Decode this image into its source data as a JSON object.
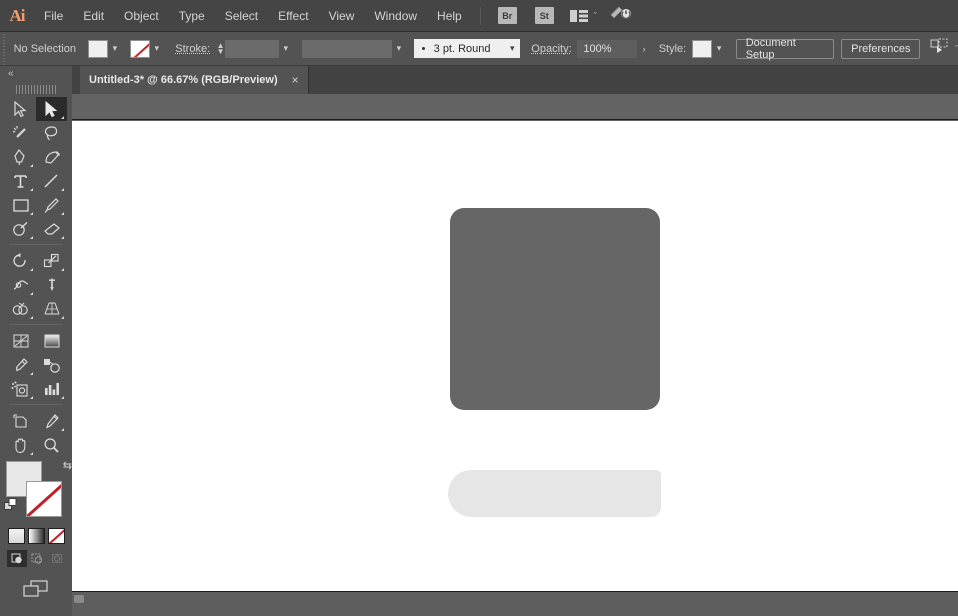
{
  "app": {
    "name": "Adobe Illustrator",
    "logo_text": "Ai"
  },
  "menubar": {
    "items": [
      {
        "label": "File"
      },
      {
        "label": "Edit"
      },
      {
        "label": "Object"
      },
      {
        "label": "Type"
      },
      {
        "label": "Select"
      },
      {
        "label": "Effect"
      },
      {
        "label": "View"
      },
      {
        "label": "Window"
      },
      {
        "label": "Help"
      }
    ],
    "bridge_label": "Br",
    "stock_label": "St",
    "arrange_icon": "arrange-documents-icon",
    "arrange_chevron": "ˇ",
    "workspace_icon": "workspace-switcher-icon"
  },
  "controlbar": {
    "selection_status": "No Selection",
    "fill_swatch": {
      "name": "fill-swatch",
      "color": "#efefef"
    },
    "stroke_swatch": {
      "name": "stroke-swatch",
      "color": "none"
    },
    "stroke_label": "Stroke:",
    "stroke_weight_value": "",
    "variable_width_value": "",
    "brush_definition": "3 pt. Round",
    "opacity_label": "Opacity:",
    "opacity_value": "100%",
    "opacity_more": "›",
    "style_label": "Style:",
    "style_swatch_color": "#efefef",
    "document_setup_label": "Document Setup",
    "preferences_label": "Preferences",
    "align_icon": "align-transform-icon",
    "chevron": "ˇ"
  },
  "tabstrip": {
    "document_title": "Untitled-3* @ 66.67% (RGB/Preview)",
    "close_glyph": "×"
  },
  "toolbar": {
    "collapse_glyph": "«",
    "tools": [
      {
        "name": "selection-tool",
        "label": "Selection",
        "active": false,
        "flyout": false
      },
      {
        "name": "direct-selection-tool",
        "label": "Direct Selection",
        "active": true,
        "flyout": true
      },
      {
        "name": "magic-wand-tool",
        "label": "Magic Wand",
        "active": false,
        "flyout": false
      },
      {
        "name": "lasso-tool",
        "label": "Lasso",
        "active": false,
        "flyout": false
      },
      {
        "name": "pen-tool",
        "label": "Pen",
        "active": false,
        "flyout": true
      },
      {
        "name": "curvature-tool",
        "label": "Curvature",
        "active": false,
        "flyout": false
      },
      {
        "name": "type-tool",
        "label": "Type",
        "active": false,
        "flyout": true
      },
      {
        "name": "line-segment-tool",
        "label": "Line Segment",
        "active": false,
        "flyout": true
      },
      {
        "name": "rectangle-tool",
        "label": "Rectangle",
        "active": false,
        "flyout": true
      },
      {
        "name": "paintbrush-tool",
        "label": "Paintbrush",
        "active": false,
        "flyout": true
      },
      {
        "name": "shaper-tool",
        "label": "Shaper",
        "active": false,
        "flyout": true
      },
      {
        "name": "eraser-tool",
        "label": "Eraser",
        "active": false,
        "flyout": true
      },
      {
        "name": "rotate-tool",
        "label": "Rotate",
        "active": false,
        "flyout": true
      },
      {
        "name": "scale-tool",
        "label": "Scale",
        "active": false,
        "flyout": true
      },
      {
        "name": "width-tool",
        "label": "Width",
        "active": false,
        "flyout": true
      },
      {
        "name": "free-transform-tool",
        "label": "Free Transform",
        "active": false,
        "flyout": false
      },
      {
        "name": "shape-builder-tool",
        "label": "Shape Builder",
        "active": false,
        "flyout": true
      },
      {
        "name": "perspective-grid-tool",
        "label": "Perspective Grid",
        "active": false,
        "flyout": true
      },
      {
        "name": "mesh-tool",
        "label": "Mesh",
        "active": false,
        "flyout": false
      },
      {
        "name": "gradient-tool",
        "label": "Gradient",
        "active": false,
        "flyout": false
      },
      {
        "name": "eyedropper-tool",
        "label": "Eyedropper",
        "active": false,
        "flyout": true
      },
      {
        "name": "blend-tool",
        "label": "Blend",
        "active": false,
        "flyout": false
      },
      {
        "name": "symbol-sprayer-tool",
        "label": "Symbol Sprayer",
        "active": false,
        "flyout": true
      },
      {
        "name": "column-graph-tool",
        "label": "Column Graph",
        "active": false,
        "flyout": true
      },
      {
        "name": "artboard-tool",
        "label": "Artboard",
        "active": false,
        "flyout": false
      },
      {
        "name": "slice-tool",
        "label": "Slice",
        "active": false,
        "flyout": true
      },
      {
        "name": "hand-tool",
        "label": "Hand",
        "active": false,
        "flyout": true
      },
      {
        "name": "zoom-tool",
        "label": "Zoom",
        "active": false,
        "flyout": false
      }
    ],
    "fill_color": "#e8e8e8",
    "stroke_color": "none",
    "swap_glyph": "⇆",
    "color_mode_label": "Color",
    "gradient_mode_label": "Gradient",
    "none_mode_label": "None",
    "draw_modes": [
      {
        "name": "draw-normal-button",
        "label": "Draw Normal",
        "active": true
      },
      {
        "name": "draw-behind-button",
        "label": "Draw Behind",
        "active": false
      },
      {
        "name": "draw-inside-button",
        "label": "Draw Inside",
        "active": false
      }
    ],
    "screen_mode_label": "Change Screen Mode"
  },
  "canvas": {
    "shapes": [
      {
        "name": "artwork-body-rect",
        "fill": "#666666",
        "shape": "rounded-rectangle"
      },
      {
        "name": "artwork-footer-rect",
        "fill": "#e6e6e6",
        "shape": "rounded-rectangle"
      }
    ]
  }
}
